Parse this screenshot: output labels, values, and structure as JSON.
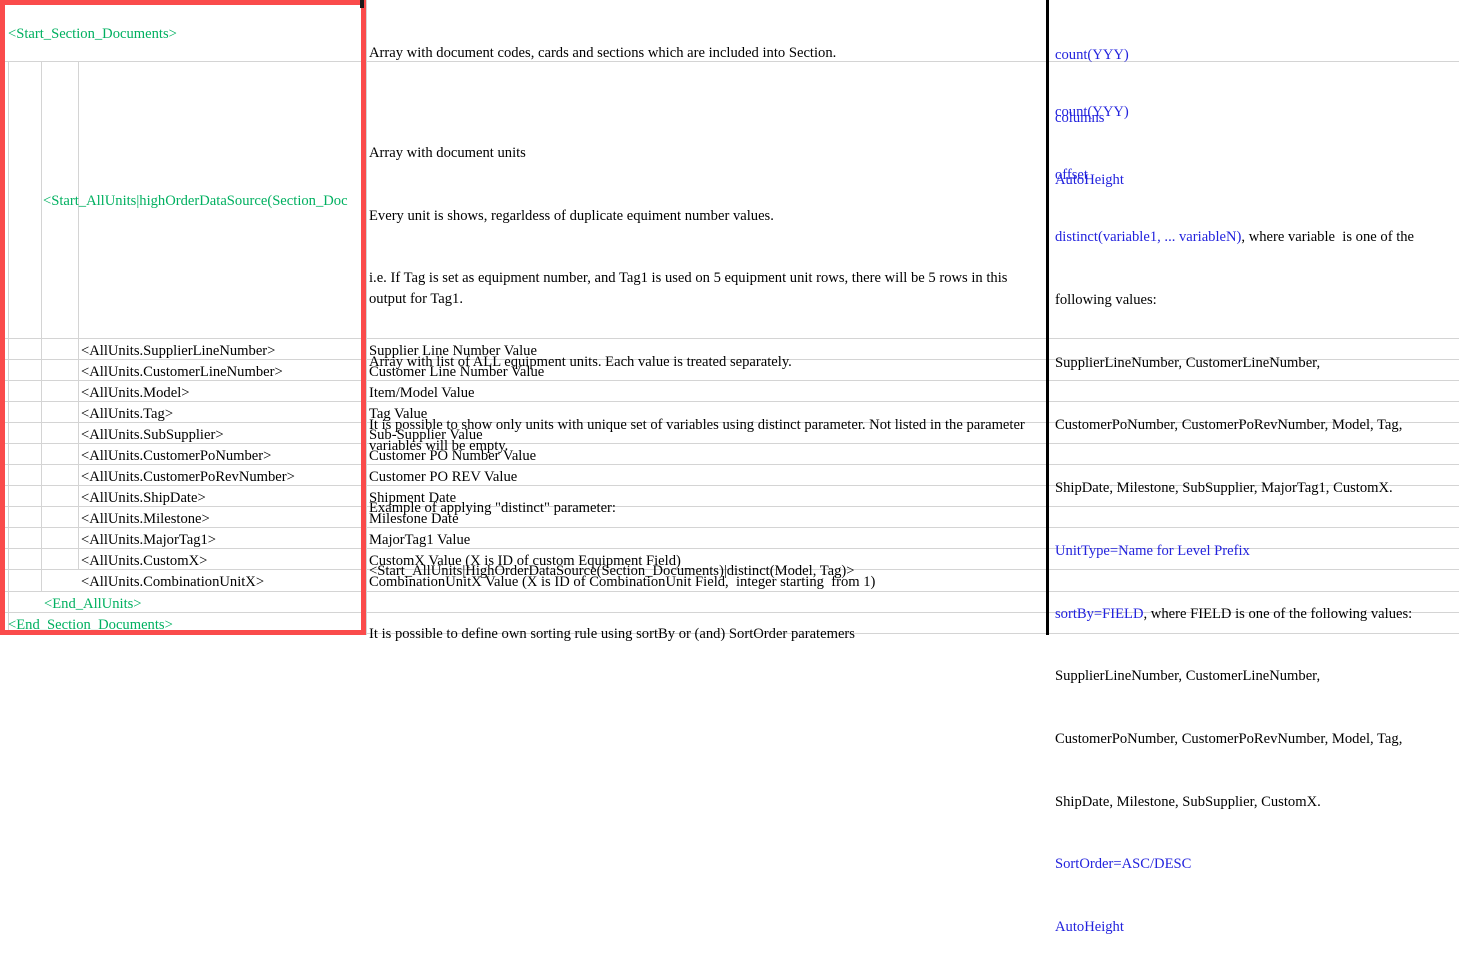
{
  "document": {
    "type": "spreadsheet-template-reference",
    "selection_color": "#fa4b4b",
    "tag_color": "#00b060",
    "parameter_color": "#2222dd"
  },
  "sections": {
    "section_documents_start": "<Start_Section_Documents>",
    "section_documents_start_desc": "Array with document codes, cards and sections which are included into Section.",
    "section_documents_params": [
      {
        "text": "count(YYY)",
        "color": "blue"
      },
      {
        "text": "columns",
        "color": "blue"
      },
      {
        "text": "AutoHeight",
        "color": "blue"
      }
    ],
    "allunits_start": "<Start_AllUnits|highOrderDataSource(Section_Doc",
    "allunits_start_desc_lines": [
      "Array with document units",
      "Every unit is shows, regarldess of duplicate equiment number values.",
      "i.e. If Tag is set as equipment number, and Tag1 is used on 5 equipment unit rows, there will be 5 rows in this output for Tag1.",
      "Array with list of ALL equipment units. Each value is treated separately.",
      "It is possible to show only units with unique set of variables using distinct parameter. Not listed in the parameter variables will be empty.",
      "Example of applying \"distinct\" parameter:",
      "<Start_AllUnits|HighOrderDataSource(Section_Documents)|distinct(Model, Tag)>",
      "It is possible to define own sorting rule using sortBy or (and) SortOrder paratemers"
    ],
    "allunits_params": [
      {
        "blue": "count(YYY)",
        "black": ""
      },
      {
        "blue": "offset",
        "black": ""
      },
      {
        "blue": "distinct(variable1, ... variableN)",
        "black": ", where variable  is one of the"
      },
      {
        "blue": "",
        "black": "following values:"
      },
      {
        "blue": "",
        "black": "SupplierLineNumber, CustomerLineNumber,"
      },
      {
        "blue": "",
        "black": "CustomerPoNumber, CustomerPoRevNumber, Model, Tag,"
      },
      {
        "blue": "",
        "black": "ShipDate, Milestone, SubSupplier, MajorTag1, CustomX."
      },
      {
        "blue": "UnitType=Name for Level Prefix",
        "black": ""
      },
      {
        "blue": "sortBy=FIELD",
        "black": ", where FIELD is one of the following values:"
      },
      {
        "blue": "",
        "black": "SupplierLineNumber, CustomerLineNumber,"
      },
      {
        "blue": "",
        "black": "CustomerPoNumber, CustomerPoRevNumber, Model, Tag,"
      },
      {
        "blue": "",
        "black": "ShipDate, Milestone, SubSupplier, CustomX."
      },
      {
        "blue": "SortOrder=ASC/DESC",
        "black": ""
      },
      {
        "blue": "AutoHeight",
        "black": ""
      }
    ],
    "allunits_end": "<End_AllUnits>",
    "section_documents_end": "<End_Section_Documents>"
  },
  "field_rows": [
    {
      "tag": "<AllUnits.SupplierLineNumber>",
      "description": "Supplier Line Number Value"
    },
    {
      "tag": "<AllUnits.CustomerLineNumber>",
      "description": "Customer Line Number Value"
    },
    {
      "tag": "<AllUnits.Model>",
      "description": "Item/Model Value"
    },
    {
      "tag": "<AllUnits.Tag>",
      "description": "Tag Value"
    },
    {
      "tag": "<AllUnits.SubSupplier>",
      "description": "Sub-Supplier Value"
    },
    {
      "tag": "<AllUnits.CustomerPoNumber>",
      "description": "Customer PO Number Value"
    },
    {
      "tag": "<AllUnits.CustomerPoRevNumber>",
      "description": "Customer PO REV Value"
    },
    {
      "tag": "<AllUnits.ShipDate>",
      "description": "Shipment Date"
    },
    {
      "tag": "<AllUnits.Milestone>",
      "description": "Milestone Date"
    },
    {
      "tag": "<AllUnits.MajorTag1>",
      "description": "MajorTag1 Value"
    },
    {
      "tag": "<AllUnits.CustomX>",
      "description": "CustomX Value (X is ID of custom Equipment Field)"
    },
    {
      "tag": "<AllUnits.CombinationUnitX>",
      "description": "CombinationUnitX Value (X is ID of CombinationUnit Field,  integer starting  from 1)"
    }
  ]
}
